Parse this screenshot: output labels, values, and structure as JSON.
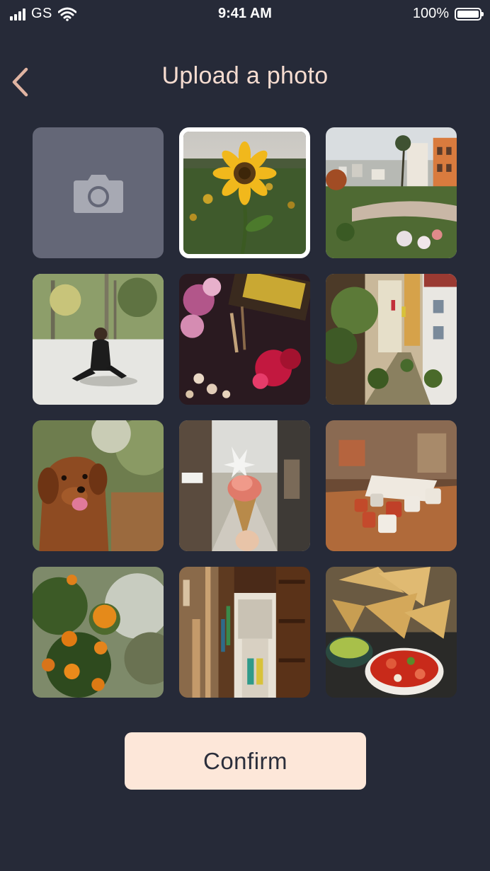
{
  "status_bar": {
    "carrier": "GS",
    "time": "9:41 AM",
    "battery": "100%"
  },
  "header": {
    "back_icon": "chevron-left-icon",
    "title": "Upload a photo"
  },
  "grid": {
    "camera_tile_icon": "camera-icon",
    "selected_index": 1,
    "photos": [
      {
        "name": "photo-sunflower"
      },
      {
        "name": "photo-city-street"
      },
      {
        "name": "photo-woman-sitting"
      },
      {
        "name": "photo-flowers-bouquet"
      },
      {
        "name": "photo-alley-houses"
      },
      {
        "name": "photo-dog"
      },
      {
        "name": "photo-ice-cream"
      },
      {
        "name": "photo-coffee-cups"
      },
      {
        "name": "photo-oranges"
      },
      {
        "name": "photo-bookstore"
      },
      {
        "name": "photo-nachos"
      }
    ]
  },
  "confirm": {
    "label": "Confirm"
  },
  "colors": {
    "background": "#262a38",
    "title": "#f6dcd0",
    "back_chevron": "#e0b4a2",
    "camera_tile": "#646777",
    "confirm_bg": "#fde7d9",
    "confirm_text": "#2b2e3b"
  }
}
